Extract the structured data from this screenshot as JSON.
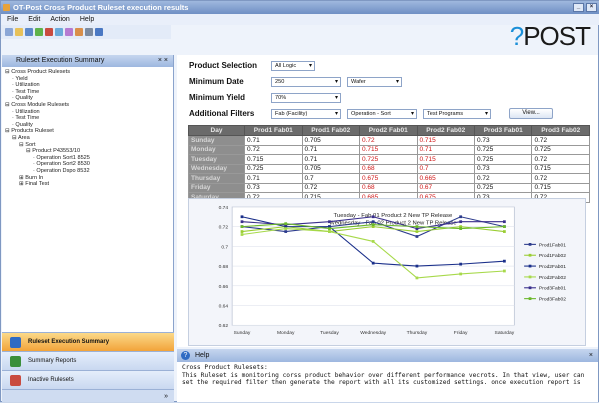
{
  "window": {
    "title": "OT-Post Cross Product Ruleset execution results",
    "menu": [
      "File",
      "Edit",
      "Action",
      "Help"
    ],
    "logo": {
      "prefix": "?",
      "text": "POST"
    }
  },
  "left_panel": {
    "title": "Ruleset Execution Summary",
    "close": "× ×"
  },
  "tree": [
    {
      "label": "Cross Product Rulesets",
      "level": 0
    },
    {
      "label": "Yield",
      "level": 1
    },
    {
      "label": "Utilization",
      "level": 1
    },
    {
      "label": "Test Time",
      "level": 1
    },
    {
      "label": "Quality",
      "level": 1
    },
    {
      "label": "Cross Module Rulesets",
      "level": 0
    },
    {
      "label": "Utilization",
      "level": 1
    },
    {
      "label": "Test Time",
      "level": 1
    },
    {
      "label": "Quality",
      "level": 1
    },
    {
      "label": "Products Ruleset",
      "level": 0
    },
    {
      "label": "Area",
      "level": 1
    },
    {
      "label": "Sort",
      "level": 2
    },
    {
      "label": "Product P43553/10",
      "level": 3
    },
    {
      "label": "Operation Sort1 8525",
      "level": 4
    },
    {
      "label": "Operation Sort2 8530",
      "level": 4
    },
    {
      "label": "Operation Dspo 8532",
      "level": 4
    },
    {
      "label": "Burn In",
      "level": 2
    },
    {
      "label": "Final Test",
      "level": 2
    }
  ],
  "nav": [
    {
      "label": "Ruleset Execution Summary",
      "active": true,
      "icon": "ruleset-icon"
    },
    {
      "label": "Summary Reports",
      "active": false,
      "icon": "chart-icon"
    },
    {
      "label": "Inactive Rulesets",
      "active": false,
      "icon": "inactive-icon"
    }
  ],
  "nav_more": "»",
  "filters": {
    "product_selection": {
      "label": "Product Selection",
      "value": "All Logic"
    },
    "minimum_date": {
      "label": "Minimum Date",
      "value": "250",
      "unit": "Wafer"
    },
    "minimum_yield": {
      "label": "Minimum Yield",
      "value": "70%"
    },
    "additional": {
      "label": "Additional Filters",
      "values": [
        "Fab (Facility)",
        "Operation - Sort",
        "Test Programs"
      ]
    },
    "view_label": "View..."
  },
  "table": {
    "headers": [
      "Day",
      "Prod1 Fab01",
      "Prod1 Fab02",
      "Prod2 Fab01",
      "Prod2 Fab02",
      "Prod3 Fab01",
      "Prod3 Fab02"
    ],
    "rows": [
      {
        "day": "Sunday",
        "v": [
          "0.71",
          "0.705",
          "0.72",
          "0.715",
          "0.73",
          "0.72"
        ]
      },
      {
        "day": "Monday",
        "v": [
          "0.72",
          "0.71",
          "0.715",
          "0.71",
          "0.725",
          "0.725"
        ]
      },
      {
        "day": "Tuesday",
        "v": [
          "0.715",
          "0.71",
          "0.725",
          "0.715",
          "0.725",
          "0.72"
        ]
      },
      {
        "day": "Wednesday",
        "v": [
          "0.725",
          "0.705",
          "0.68",
          "0.7",
          "0.73",
          "0.715"
        ]
      },
      {
        "day": "Thursday",
        "v": [
          "0.71",
          "0.7",
          "0.675",
          "0.665",
          "0.72",
          "0.72"
        ]
      },
      {
        "day": "Friday",
        "v": [
          "0.73",
          "0.72",
          "0.68",
          "0.67",
          "0.725",
          "0.715"
        ]
      },
      {
        "day": "Saturday",
        "v": [
          "0.72",
          "0.715",
          "0.685",
          "0.675",
          "0.73",
          "0.72"
        ]
      }
    ],
    "red_cols": [
      2,
      3
    ]
  },
  "chart_data": {
    "type": "line",
    "title": "Tuesday - Fab 01 Product 2 New TP Release",
    "subtitle": "Wednesday - Fab 02 Product 2 New TP Release",
    "categories": [
      "Sunday",
      "Monday",
      "Tuesday",
      "Wednesday",
      "Thursday",
      "Friday",
      "Saturday"
    ],
    "ylim": [
      0.62,
      0.74
    ],
    "yticks": [
      "0.62",
      "0.64",
      "0.66",
      "0.68",
      "0.7",
      "0.72",
      "0.74"
    ],
    "legend_position": "right",
    "series": [
      {
        "name": "Prod1Fab01",
        "color": "#2c3b8c",
        "values": [
          0.72,
          0.715,
          0.72,
          0.725,
          0.71,
          0.73,
          0.72
        ]
      },
      {
        "name": "Prod1Fab02",
        "color": "#9acd32",
        "values": [
          0.715,
          0.72,
          0.715,
          0.72,
          0.715,
          0.72,
          0.715
        ]
      },
      {
        "name": "Prod2Fab01",
        "color": "#1a2f8a",
        "values": [
          0.73,
          0.72,
          0.72,
          0.683,
          0.68,
          0.682,
          0.685
        ]
      },
      {
        "name": "Prod2Fab02",
        "color": "#a7d94a",
        "values": [
          0.712,
          0.718,
          0.715,
          0.705,
          0.668,
          0.672,
          0.675
        ]
      },
      {
        "name": "Prod3Fab01",
        "color": "#3a2f8c",
        "values": [
          0.725,
          0.722,
          0.725,
          0.73,
          0.718,
          0.725,
          0.725
        ]
      },
      {
        "name": "Prod3Fab02",
        "color": "#6bb82a",
        "values": [
          0.72,
          0.723,
          0.718,
          0.722,
          0.72,
          0.718,
          0.72
        ]
      }
    ]
  },
  "help": {
    "title": "Help",
    "close": "×",
    "heading": "Cross Product Rulesets:",
    "body": "This Ruleset is monitoring corss product behavior over different performance vecrots. In that view, user can set the required filter then generate the report with all its customized settings. once execution report is"
  }
}
